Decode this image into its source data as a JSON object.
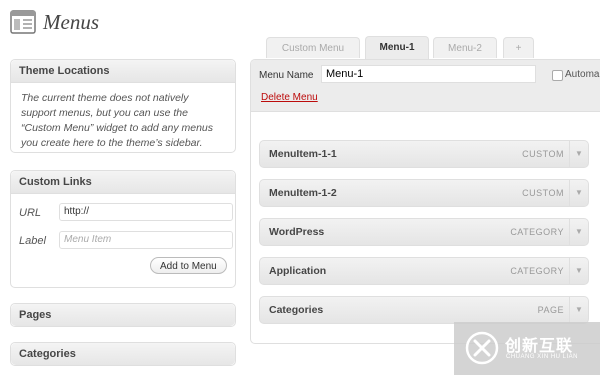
{
  "page": {
    "title": "Menus",
    "icon": "menus-page-icon"
  },
  "theme_locations": {
    "heading": "Theme Locations",
    "description": "The current theme does not natively support menus, but you can use the “Custom Menu” widget to add any menus you create here to the theme’s sidebar."
  },
  "custom_links": {
    "heading": "Custom Links",
    "url_label": "URL",
    "url_value": "http://",
    "label_label": "Label",
    "label_placeholder": "Menu Item",
    "add_button": "Add to Menu"
  },
  "pages_box": {
    "heading": "Pages"
  },
  "categories_box": {
    "heading": "Categories"
  },
  "tabs": [
    {
      "label": "Custom Menu",
      "active": false
    },
    {
      "label": "Menu-1",
      "active": true
    },
    {
      "label": "Menu-2",
      "active": false
    },
    {
      "label": "+",
      "active": false
    }
  ],
  "menu_editor": {
    "name_label": "Menu Name",
    "name_value": "Menu-1",
    "auto_label": "Automa",
    "delete_link": "Delete Menu",
    "items": [
      {
        "title": "MenuItem-1-1",
        "type": "CUSTOM"
      },
      {
        "title": "MenuItem-1-2",
        "type": "CUSTOM"
      },
      {
        "title": "WordPress",
        "type": "CATEGORY"
      },
      {
        "title": "Application",
        "type": "CATEGORY"
      },
      {
        "title": "Categories",
        "type": "PAGE"
      }
    ]
  },
  "watermark": {
    "cn": "创新互联",
    "en": "CHUANG XIN HU LIAN"
  },
  "colors": {
    "delete_link": "#bc0b0b",
    "panel_bg": "#ececec",
    "border": "#dfdfdf"
  }
}
